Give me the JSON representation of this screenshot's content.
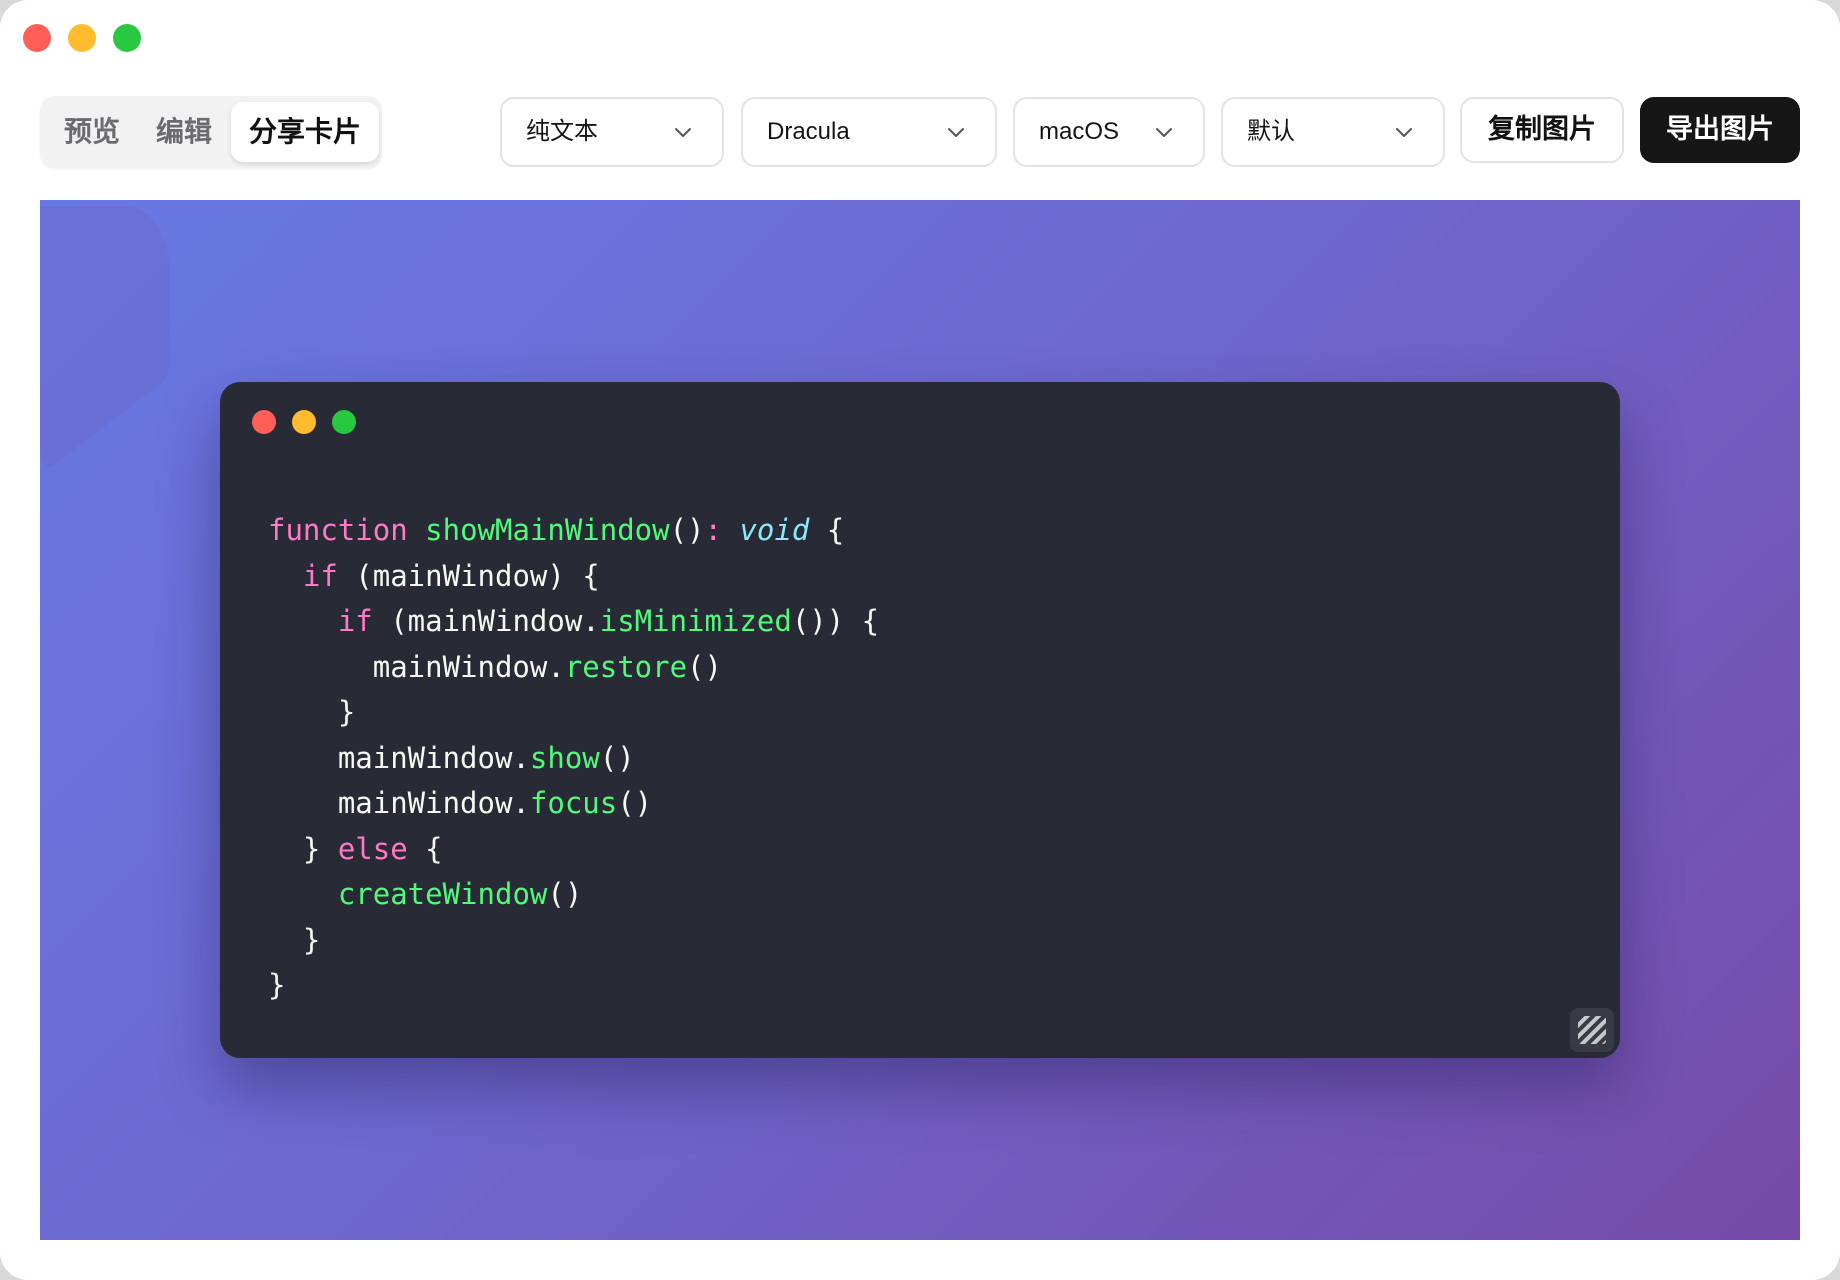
{
  "window": {
    "traffic_lights": [
      "close",
      "minimize",
      "zoom"
    ]
  },
  "toolbar": {
    "tabs": [
      {
        "label": "预览",
        "active": false
      },
      {
        "label": "编辑",
        "active": false
      },
      {
        "label": "分享卡片",
        "active": true
      }
    ],
    "selects": [
      {
        "value": "纯文本"
      },
      {
        "value": "Dracula"
      },
      {
        "value": "macOS"
      },
      {
        "value": "默认"
      }
    ],
    "copy_label": "复制图片",
    "export_label": "导出图片"
  },
  "preview": {
    "background_colors": [
      "#6779e4",
      "#764ba8"
    ],
    "card": {
      "theme_bg": "#282a36",
      "code_lines": [
        [
          {
            "t": "kw",
            "v": "function"
          },
          {
            "t": "pl",
            "v": " "
          },
          {
            "t": "fn",
            "v": "showMainWindow"
          },
          {
            "t": "pl",
            "v": "()"
          },
          {
            "t": "kw",
            "v": ":"
          },
          {
            "t": "pl",
            "v": " "
          },
          {
            "t": "ty",
            "v": "void"
          },
          {
            "t": "pl",
            "v": " {"
          }
        ],
        [
          {
            "t": "pl",
            "v": "  "
          },
          {
            "t": "kw",
            "v": "if"
          },
          {
            "t": "pl",
            "v": " (mainWindow) {"
          }
        ],
        [
          {
            "t": "pl",
            "v": "    "
          },
          {
            "t": "kw",
            "v": "if"
          },
          {
            "t": "pl",
            "v": " (mainWindow."
          },
          {
            "t": "fn",
            "v": "isMinimized"
          },
          {
            "t": "pl",
            "v": "()) {"
          }
        ],
        [
          {
            "t": "pl",
            "v": "      mainWindow."
          },
          {
            "t": "fn",
            "v": "restore"
          },
          {
            "t": "pl",
            "v": "()"
          }
        ],
        [
          {
            "t": "pl",
            "v": "    }"
          }
        ],
        [
          {
            "t": "pl",
            "v": "    mainWindow."
          },
          {
            "t": "fn",
            "v": "show"
          },
          {
            "t": "pl",
            "v": "()"
          }
        ],
        [
          {
            "t": "pl",
            "v": "    mainWindow."
          },
          {
            "t": "fn",
            "v": "focus"
          },
          {
            "t": "pl",
            "v": "()"
          }
        ],
        [
          {
            "t": "pl",
            "v": "  } "
          },
          {
            "t": "kw",
            "v": "else"
          },
          {
            "t": "pl",
            "v": " {"
          }
        ],
        [
          {
            "t": "pl",
            "v": "    "
          },
          {
            "t": "fn",
            "v": "createWindow"
          },
          {
            "t": "pl",
            "v": "()"
          }
        ],
        [
          {
            "t": "pl",
            "v": "  }"
          }
        ],
        [
          {
            "t": "pl",
            "v": "}"
          }
        ]
      ]
    }
  }
}
